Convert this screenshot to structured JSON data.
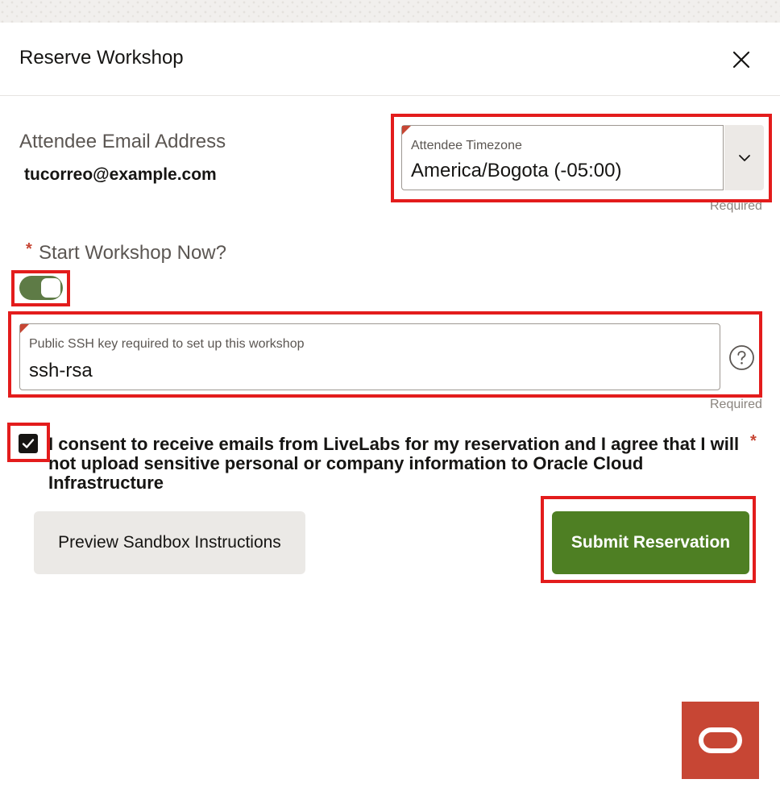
{
  "dialog": {
    "title": "Reserve Workshop"
  },
  "icons": {
    "close": "close-icon",
    "dropdown": "chevron-down-icon",
    "help": "help-circle-icon",
    "checkmark": "check-icon",
    "logo": "oracle-logo-icon"
  },
  "form": {
    "email_label": "Attendee Email Address",
    "email_value": "tucorreo@example.com",
    "timezone": {
      "label": "Attendee Timezone",
      "value": "America/Bogota (-05:00)",
      "required_text": "Required"
    },
    "start_now": {
      "asterisk": "*",
      "label": "Start Workshop Now?",
      "enabled": true
    },
    "ssh_key": {
      "label": "Public SSH key required to set up this workshop",
      "value": "ssh-rsa",
      "required_text": "Required"
    },
    "consent": {
      "checked": true,
      "text": "I consent to receive emails from LiveLabs for my reservation and I agree that I will not upload sensitive personal or company information to Oracle Cloud Infrastructure",
      "asterisk": "*"
    }
  },
  "actions": {
    "preview_label": "Preview Sandbox Instructions",
    "submit_label": "Submit Reservation"
  },
  "colors": {
    "accent_green": "#4e7f23",
    "toggle_green": "#5e7b46",
    "required_red": "#c74634",
    "highlight_red": "#e31c1c",
    "brand_red": "#c74634"
  }
}
